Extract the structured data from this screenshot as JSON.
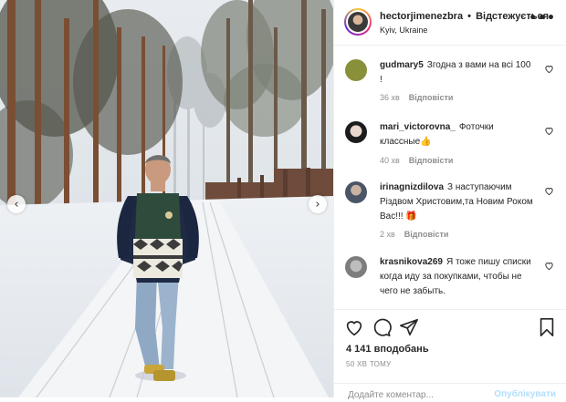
{
  "post": {
    "author": "hectorjimenezbra",
    "follow_status": "Відстежується",
    "location": "Kyiv, Ukraine"
  },
  "comments": [
    {
      "user": "gudmary5",
      "text": "Згодна з вами на всі 100 !",
      "time": "36 хв",
      "reply": "Відповісти",
      "avatar_color": "#8a8f3a"
    },
    {
      "user": "mari_victorovna_",
      "text": "Фоточки классные👍",
      "time": "40 хв",
      "reply": "Відповісти",
      "avatar_color": "#2b2b2b"
    },
    {
      "user": "irinagnizdilova",
      "text": "З наступаючим Різдвом Христовим,та Новим Роком Вас!!! 🎁",
      "time": "2 хв",
      "reply": "Відповісти",
      "avatar_color": "#4a5568"
    },
    {
      "user": "krasnikova269",
      "text": "Я тоже пишу списки когда иду за покупками, чтобы не чего не забыть.",
      "time": "",
      "reply": "",
      "avatar_color": "#9a9a9a"
    }
  ],
  "actions": {
    "likes": "4 141 вподобань",
    "timestamp": "50 ХВ ТОМУ",
    "comment_placeholder": "Додайте коментар...",
    "publish_label": "Опублікувати"
  },
  "icons": {
    "like": "heart-icon",
    "comment": "comment-icon",
    "share": "share-icon",
    "save": "bookmark-icon",
    "more": "more-options-icon",
    "prev": "chevron-left-icon",
    "next": "chevron-right-icon"
  },
  "colors": {
    "muted": "#8e8e8e",
    "publish_disabled": "#b2dffc",
    "border": "#efefef"
  }
}
